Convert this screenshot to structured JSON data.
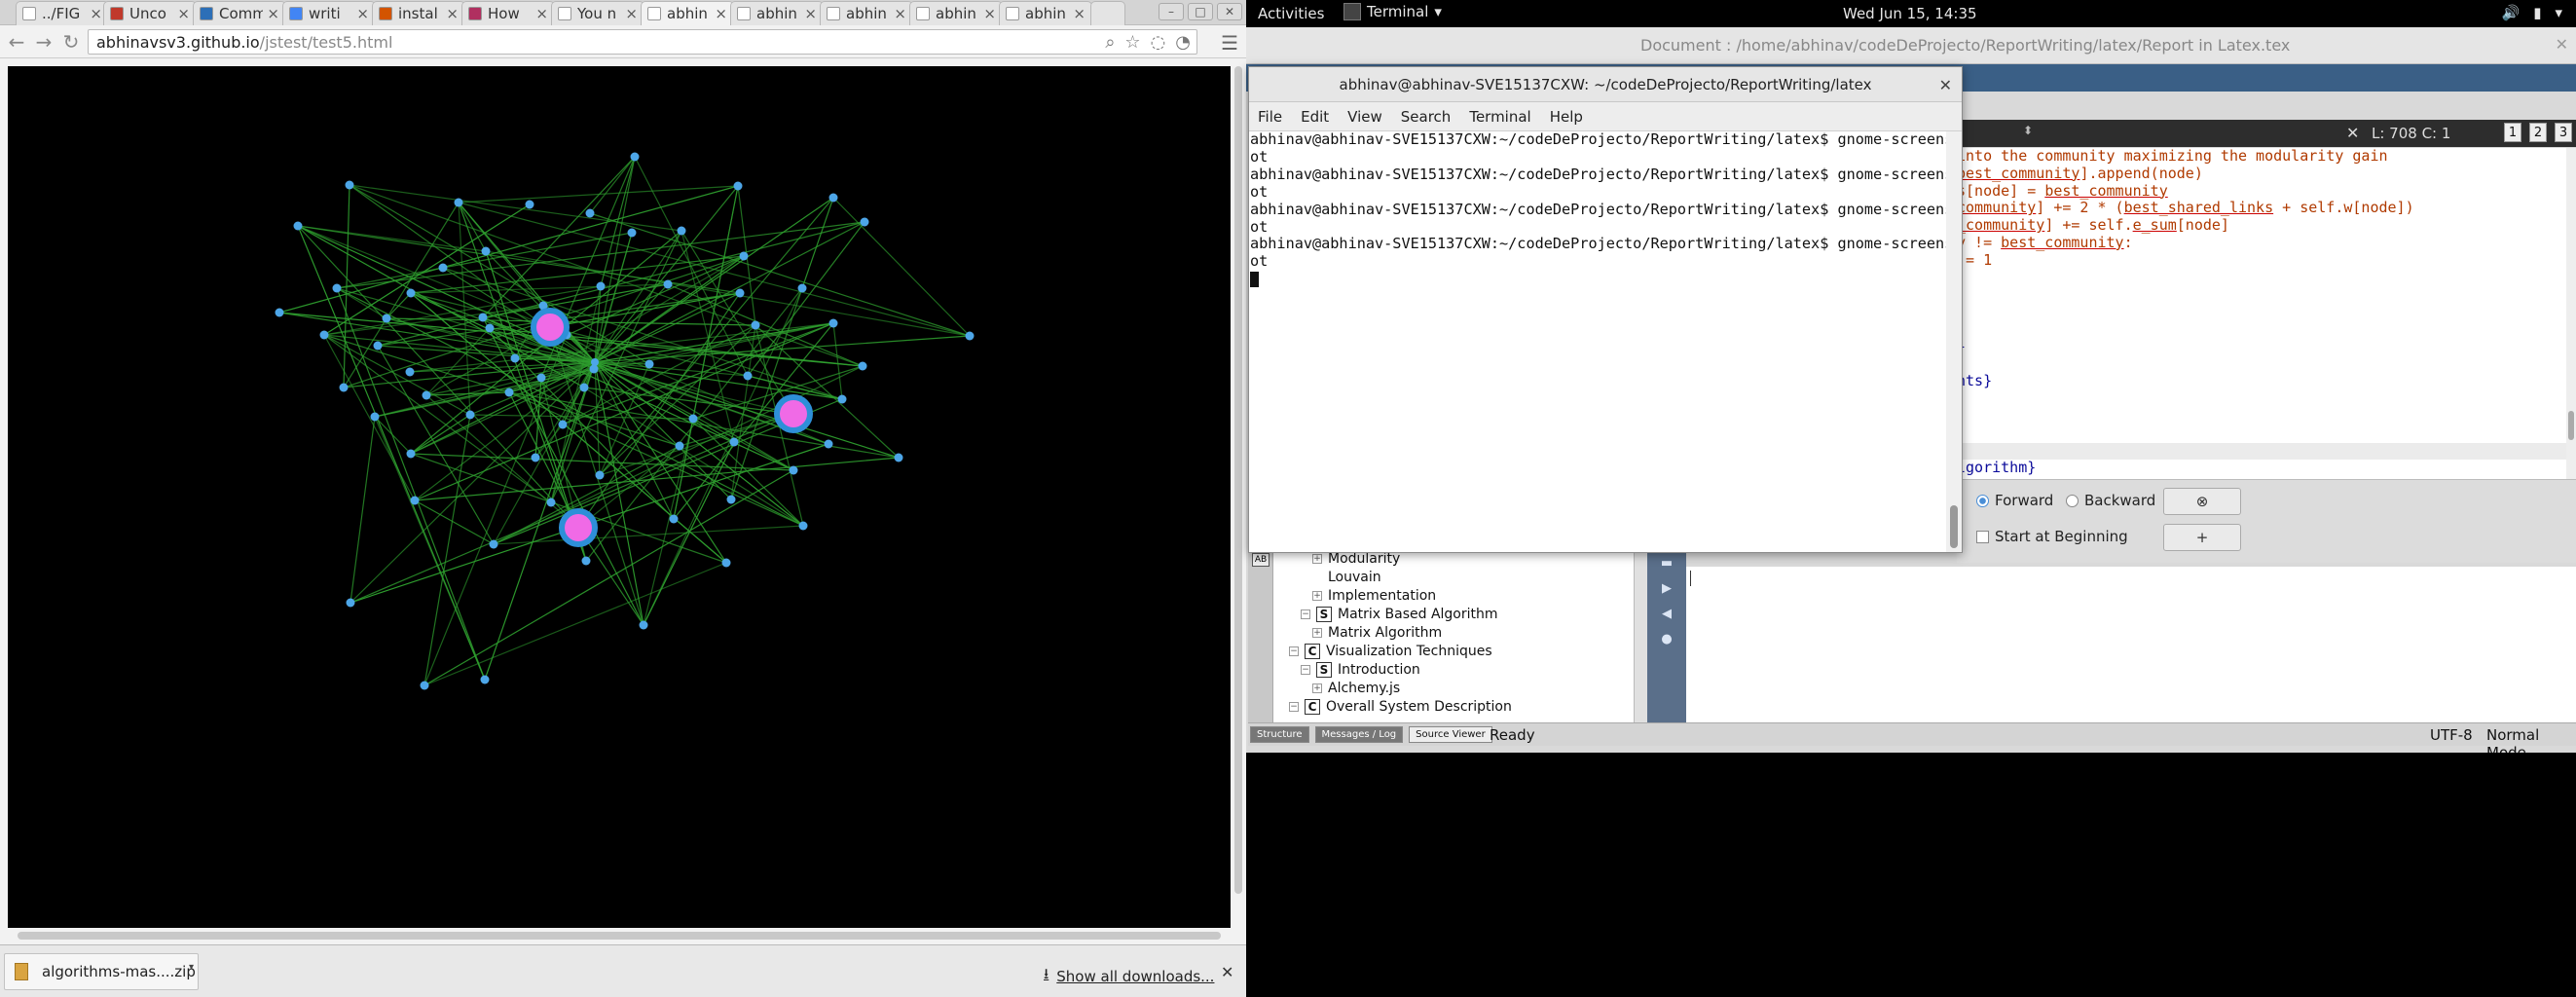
{
  "browser": {
    "tabs": [
      {
        "label": "../FIG",
        "favicon_color": "#ffffff"
      },
      {
        "label": "Unco",
        "favicon_color": "#c0392b"
      },
      {
        "label": "Comm",
        "favicon_color": "#2c6fb7"
      },
      {
        "label": "writi",
        "favicon_color": "#4285f4"
      },
      {
        "label": "instal",
        "favicon_color": "#d35400"
      },
      {
        "label": "How",
        "favicon_color": "#b03060"
      },
      {
        "label": "You n",
        "favicon_color": "#ffffff"
      },
      {
        "label": "abhin",
        "favicon_color": "#ffffff"
      },
      {
        "label": "abhin",
        "favicon_color": "#ffffff"
      },
      {
        "label": "abhin",
        "favicon_color": "#ffffff"
      },
      {
        "label": "abhin",
        "favicon_color": "#ffffff"
      },
      {
        "label": "abhin",
        "favicon_color": "#ffffff"
      }
    ],
    "url_host": "abhinavsv3.github.io",
    "url_path": "/jstest/test5.html",
    "download": {
      "file": "algorithms-mas....zip",
      "show_all": "Show all downloads..."
    }
  },
  "graph": {
    "background": "#000000",
    "edge_color": "#2e9e2e",
    "node_color": "#4da6e8",
    "big_node_fill": "#f06ae6",
    "big_node_ring": "#2e8fd8"
  },
  "desktop": {
    "activities": "Activities",
    "app_menu": "Terminal",
    "clock": "Wed Jun 15, 14:35"
  },
  "texmaker": {
    "title": "Document : /home/abhinav/codeDeProjecto/ReportWriting/latex/Report in Latex.tex",
    "line_col": "L: 708 C: 1",
    "views": [
      "1",
      "2",
      "3"
    ],
    "editor_lines": [
      [
        {
          "t": "into the community maximizing the modularity gain",
          "c": "br"
        }
      ],
      [
        {
          "t": "best_community",
          "c": "u"
        },
        {
          "t": "].append(node)",
          "c": "br"
        }
      ],
      [
        {
          "t": "s[node] = ",
          "c": "br"
        },
        {
          "t": "best_community",
          "c": "u"
        }
      ],
      [
        {
          "t": "community",
          "c": "u"
        },
        {
          "t": "] += 2 * (",
          "c": "br"
        },
        {
          "t": "best_shared_links",
          "c": "u"
        },
        {
          "t": " + self.w[node])",
          "c": "br"
        }
      ],
      [
        {
          "t": "_community",
          "c": "u"
        },
        {
          "t": "] += self.",
          "c": "br"
        },
        {
          "t": "e_sum",
          "c": "u"
        },
        {
          "t": "[node]",
          "c": "br"
        }
      ],
      [
        {
          "t": "y != ",
          "c": "br"
        },
        {
          "t": "best_community",
          "c": "u"
        },
        {
          "t": ":",
          "c": "br"
        }
      ],
      [
        {
          "t": " = 1",
          "c": "br"
        }
      ],
      [],
      [],
      [],
      [],
      [
        {
          "t": "}",
          "c": "bl"
        }
      ],
      [],
      [
        {
          "t": "nts}",
          "c": "bl"
        }
      ],
      [],
      [],
      [],
      [],
      [
        {
          "t": "lgorithm}",
          "c": "bl"
        }
      ]
    ],
    "find": {
      "forward": "Forward",
      "backward": "Backward",
      "start_at_beginning": "Start at Beginning",
      "plus": "+"
    },
    "tree": [
      {
        "kind": "plus",
        "label": "Modularity",
        "indent": 1
      },
      {
        "kind": "none",
        "label": "Louvain",
        "indent": 1
      },
      {
        "kind": "plus",
        "label": "Implementation",
        "indent": 1
      },
      {
        "kind": "S",
        "label": "Matrix Based Algorithm",
        "indent": 0
      },
      {
        "kind": "plus",
        "label": "Matrix Algorithm",
        "indent": 1
      },
      {
        "kind": "C",
        "label": "Visualization Techniques",
        "indent": -1
      },
      {
        "kind": "S",
        "label": "Introduction",
        "indent": 0
      },
      {
        "kind": "plus",
        "label": "Alchemy.js",
        "indent": 1
      },
      {
        "kind": "C",
        "label": "Overall System Description",
        "indent": -1
      }
    ],
    "status": {
      "tabs": [
        "Structure",
        "Messages / Log",
        "Source Viewer"
      ],
      "ready": "Ready",
      "encoding": "UTF-8",
      "mode": "Normal Mode"
    }
  },
  "terminal": {
    "title": "abhinav@abhinav-SVE15137CXW: ~/codeDeProjecto/ReportWriting/latex",
    "menu": [
      "File",
      "Edit",
      "View",
      "Search",
      "Terminal",
      "Help"
    ],
    "lines": [
      "abhinav@abhinav-SVE15137CXW:~/codeDeProjecto/ReportWriting/latex$ gnome-screensh",
      "ot",
      "abhinav@abhinav-SVE15137CXW:~/codeDeProjecto/ReportWriting/latex$ gnome-screensh",
      "ot",
      "abhinav@abhinav-SVE15137CXW:~/codeDeProjecto/ReportWriting/latex$ gnome-screensh",
      "ot",
      "abhinav@abhinav-SVE15137CXW:~/codeDeProjecto/ReportWriting/latex$ gnome-screensh",
      "ot"
    ]
  }
}
